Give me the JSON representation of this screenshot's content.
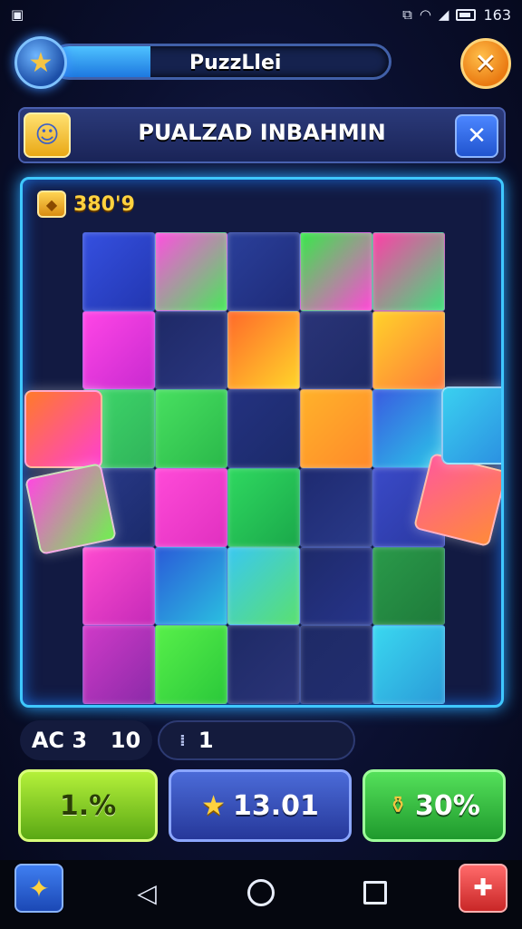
{
  "status_bar": {
    "left_icon": "notification-icon",
    "time": "163",
    "icons": [
      "vibrate-icon",
      "wifi-icon",
      "signal-icon",
      "battery-icon"
    ]
  },
  "top_bar": {
    "avatar_icon": "star-icon",
    "progress_label": "PuzzLlei",
    "progress_fraction": 0.29,
    "close_icon": "close-icon"
  },
  "title_bar": {
    "icon": "character-icon",
    "title": "PUALZAD INBAHMIN",
    "close_icon": "close-icon"
  },
  "board": {
    "score_icon": "gem-icon",
    "score": "380'9"
  },
  "counters": {
    "left_label": "AC 3",
    "left_value": "10",
    "right_marker": "⁞",
    "right_value": "1"
  },
  "actions": {
    "green_label": "1.%",
    "blue_label": "13.01",
    "blue_icon": "star-icon",
    "green2_label": "30%",
    "green2_icon": "potion-icon"
  },
  "nav": {
    "left_icon": "puzzle-icon",
    "back_icon": "back-icon",
    "home_icon": "home-icon",
    "recent_icon": "recent-apps-icon",
    "right_icon": "medkit-icon"
  },
  "colors": {
    "board_glow": "#3fc8ff",
    "accent_orange": "#ea7a12",
    "accent_green": "#5aa814",
    "accent_blue": "#26389a"
  }
}
